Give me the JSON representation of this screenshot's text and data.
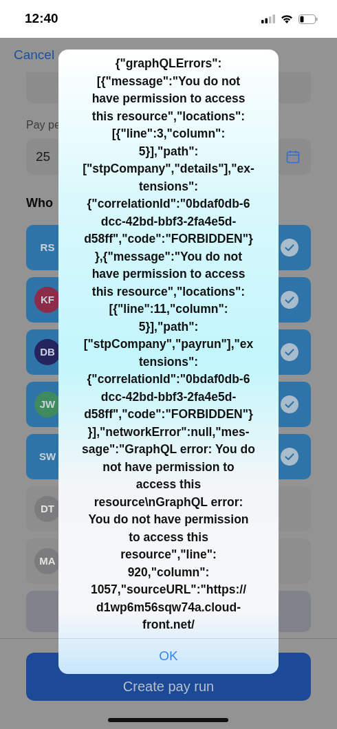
{
  "status_bar": {
    "time": "12:40"
  },
  "header": {
    "cancel": "Cancel"
  },
  "form": {
    "pay_period_label": "Pay pe",
    "pay_date_value": "25"
  },
  "section_title": "Who",
  "employees": [
    {
      "initials": "RS",
      "color": "#2f74a8",
      "selected": true
    },
    {
      "initials": "KF",
      "color": "#8c2c48",
      "selected": true
    },
    {
      "initials": "DB",
      "color": "#25245c",
      "selected": true
    },
    {
      "initials": "JW",
      "color": "#3f8a5e",
      "selected": true
    },
    {
      "initials": "SW",
      "color": "#2f74a8",
      "selected": true
    },
    {
      "initials": "DT",
      "color": "#7c7c7e",
      "selected": false
    },
    {
      "initials": "MA",
      "color": "#7c7c7e",
      "selected": false
    }
  ],
  "create_button": {
    "label": "Create pay run"
  },
  "alert": {
    "message_lines": [
      "{\"graphQLErrors\":",
      "[{\"message\":\"You do not",
      "have permission to access",
      "this resource\",\"locations\":",
      "[{\"line\":3,\"column\":",
      "5}],\"path\":",
      "[\"stpCompany\",\"details\"],\"ex-",
      "tensions\":",
      "{\"correlationId\":\"0bdaf0db-6",
      "dcc-42bd-bbf3-2fa4e5d-",
      "d58ff\",\"code\":\"FORBIDDEN\"}",
      "},{\"message\":\"You do not",
      "have permission to access",
      "this resource\",\"locations\":",
      "[{\"line\":11,\"column\":",
      "5}],\"path\":",
      "[\"stpCompany\",\"payrun\"],\"ex",
      "tensions\":",
      "{\"correlationId\":\"0bdaf0db-6",
      "dcc-42bd-bbf3-2fa4e5d-",
      "d58ff\",\"code\":\"FORBIDDEN\"}",
      "}],\"networkError\":null,\"mes-",
      "sage\":\"GraphQL error: You do",
      "not have permission to",
      "access this",
      "resource\\nGraphQL error:",
      "You do not have permission",
      "to access this",
      "resource\",\"line\":",
      "920,\"column\":",
      "1057,\"sourceURL\":\"https://",
      "d1wp6m56sqw74a.cloud-",
      "front.net/"
    ],
    "button": "OK"
  }
}
